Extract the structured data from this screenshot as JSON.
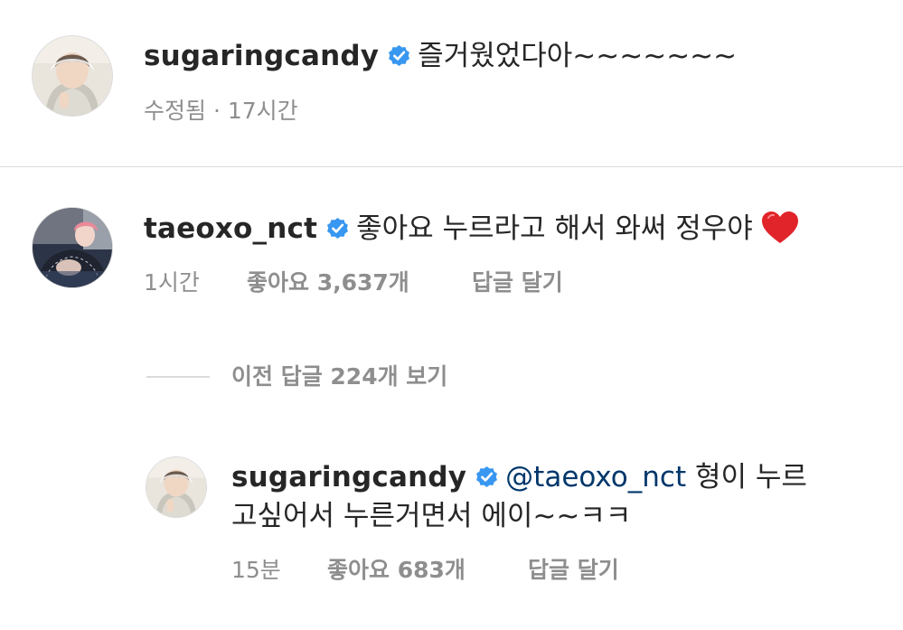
{
  "caption": {
    "username": "sugaringcandy",
    "text": "즐거웠었다아~~~~~~~",
    "edited_label": "수정됨",
    "separator": "·",
    "time": "17시간"
  },
  "comment": {
    "username": "taeoxo_nct",
    "text": "좋아요 누르라고 해서 와써 정우야",
    "emoji": "red-heart-icon",
    "time": "1시간",
    "likes": "좋아요 3,637개",
    "reply_label": "답글 달기"
  },
  "view_replies": {
    "label": "이전 답글 224개 보기"
  },
  "reply": {
    "username": "sugaringcandy",
    "mention": "@taeoxo_nct",
    "text_line1": "형이 누르",
    "text_line2": "고싶어서 누른거면서 에이~~ㅋㅋ",
    "time": "15분",
    "likes": "좋아요 683개",
    "reply_label": "답글 달기"
  },
  "colors": {
    "text": "#262626",
    "secondary": "#8e8e8e",
    "verified": "#3897f0",
    "mention": "#00376b",
    "divider": "#dbdbdb",
    "heart": "#e0242a"
  }
}
